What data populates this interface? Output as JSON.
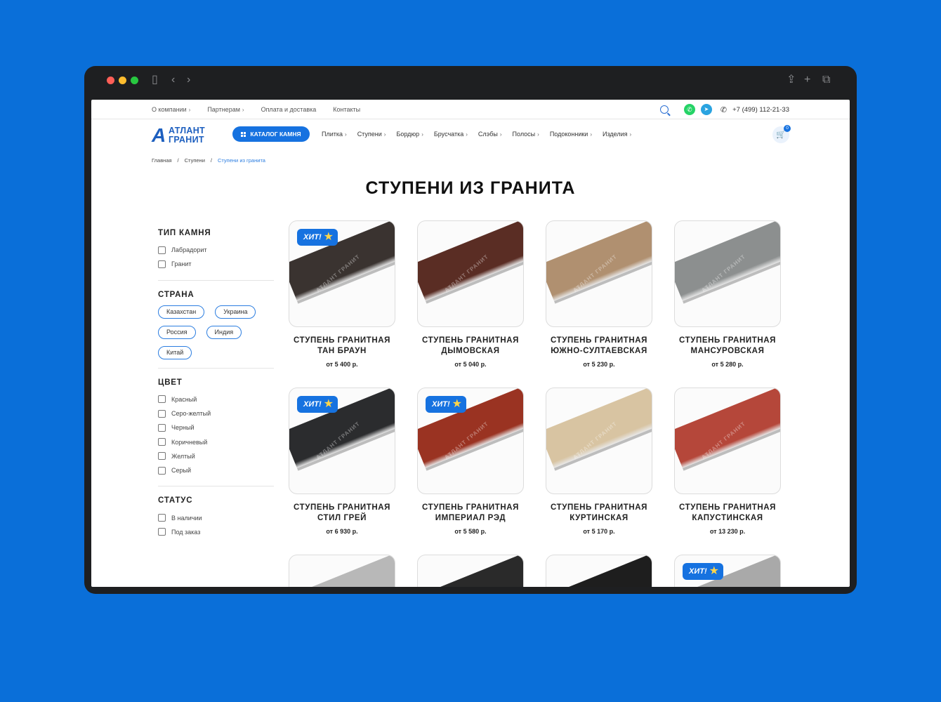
{
  "top_nav": [
    {
      "label": "О компании",
      "chevron": true
    },
    {
      "label": "Партнерам",
      "chevron": true
    },
    {
      "label": "Оплата и доставка",
      "chevron": false
    },
    {
      "label": "Контакты",
      "chevron": false
    }
  ],
  "phone": "+7 (499) 112-21-33",
  "logo": {
    "line1": "АТЛАНТ",
    "line2": "ГРАНИТ"
  },
  "catalog_button": "КАТАЛОГ КАМНЯ",
  "main_nav": [
    "Плитка",
    "Ступени",
    "Бордюр",
    "Брусчатка",
    "Слэбы",
    "Полосы",
    "Подоконники",
    "Изделия"
  ],
  "cart_count": "0",
  "breadcrumb": [
    "Главная",
    "Ступени",
    "Ступени из гранита"
  ],
  "page_title": "СТУПЕНИ ИЗ ГРАНИТА",
  "filters": {
    "stone_type": {
      "title": "ТИП КАМНЯ",
      "options": [
        "Лабрадорит",
        "Гранит"
      ]
    },
    "country": {
      "title": "СТРАНА",
      "options": [
        "Казахстан",
        "Украина",
        "Россия",
        "Индия",
        "Китай"
      ]
    },
    "color": {
      "title": "ЦВЕТ",
      "options": [
        "Красный",
        "Серо-желтый",
        "Черный",
        "Коричневый",
        "Желтый",
        "Серый"
      ]
    },
    "status": {
      "title": "СТАТУС",
      "options": [
        "В наличии",
        "Под заказ"
      ]
    }
  },
  "hit_label": "ХИТ!",
  "watermark": "АТЛАНТ ГРАНИТ",
  "colors": {
    "accent": "#1672e0",
    "background": "#0a6fd9"
  },
  "products": [
    {
      "name_line1": "СТУПЕНЬ ГРАНИТНАЯ",
      "name_line2": "ТАН БРАУН",
      "price": "от 5 400 р.",
      "hit": true,
      "color": "#3a3330"
    },
    {
      "name_line1": "СТУПЕНЬ ГРАНИТНАЯ",
      "name_line2": "ДЫМОВСКАЯ",
      "price": "от 5 040 р.",
      "hit": false,
      "color": "#5a2d24"
    },
    {
      "name_line1": "СТУПЕНЬ ГРАНИТНАЯ",
      "name_line2": "ЮЖНО-СУЛТАЕВСКАЯ",
      "price": "от 5 230 р.",
      "hit": false,
      "color": "#b09070"
    },
    {
      "name_line1": "СТУПЕНЬ ГРАНИТНАЯ",
      "name_line2": "МАНСУРОВСКАЯ",
      "price": "от 5 280 р.",
      "hit": false,
      "color": "#8c8f8f"
    },
    {
      "name_line1": "СТУПЕНЬ ГРАНИТНАЯ",
      "name_line2": "СТИЛ ГРЕЙ",
      "price": "от 6 930 р.",
      "hit": true,
      "color": "#2b2c2e"
    },
    {
      "name_line1": "СТУПЕНЬ ГРАНИТНАЯ",
      "name_line2": "ИМПЕРИАЛ РЭД",
      "price": "от 5 580 р.",
      "hit": true,
      "color": "#9a3322"
    },
    {
      "name_line1": "СТУПЕНЬ ГРАНИТНАЯ",
      "name_line2": "КУРТИНСКАЯ",
      "price": "от 5 170 р.",
      "hit": false,
      "color": "#d8c4a2"
    },
    {
      "name_line1": "СТУПЕНЬ ГРАНИТНАЯ",
      "name_line2": "КАПУСТИНСКАЯ",
      "price": "от 13 230 р.",
      "hit": false,
      "color": "#b5473a"
    },
    {
      "hit": false,
      "color": "#b8b8b8"
    },
    {
      "hit": false,
      "color": "#2a2a2a"
    },
    {
      "hit": false,
      "color": "#1e1e1e"
    },
    {
      "hit": true,
      "color": "#a9a9a9"
    }
  ]
}
